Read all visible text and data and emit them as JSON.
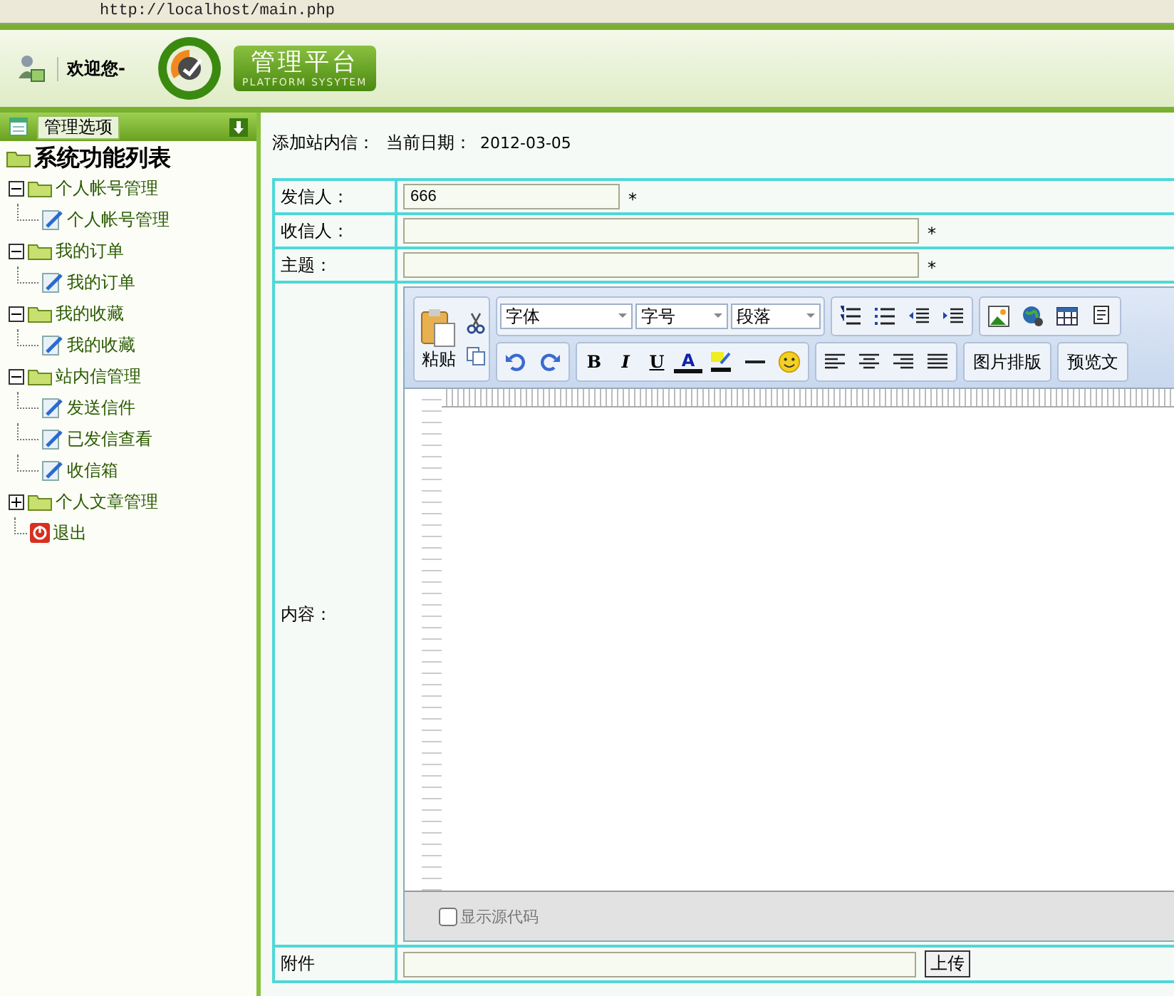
{
  "address_bar": {
    "url": "http://localhost/main.php"
  },
  "header": {
    "welcome": "欢迎您-",
    "brand": "管理平台",
    "brand_sub": "PLATFORM SYSYTEM"
  },
  "sidebar": {
    "title": "管理选项",
    "tree": {
      "label": "系统功能列表",
      "children": [
        {
          "label": "个人帐号管理",
          "expanded": true,
          "children": [
            {
              "label": "个人帐号管理"
            }
          ]
        },
        {
          "label": "我的订单",
          "expanded": true,
          "children": [
            {
              "label": "我的订单"
            }
          ]
        },
        {
          "label": "我的收藏",
          "expanded": true,
          "children": [
            {
              "label": "我的收藏"
            }
          ]
        },
        {
          "label": "站内信管理",
          "expanded": true,
          "children": [
            {
              "label": "发送信件"
            },
            {
              "label": "已发信查看"
            },
            {
              "label": "收信箱"
            }
          ]
        },
        {
          "label": "个人文章管理",
          "expanded": false
        }
      ],
      "exit": "退出"
    }
  },
  "content": {
    "heading": "添加站内信：",
    "date_label": "当前日期：",
    "date": "2012-03-05",
    "fields": [
      {
        "label": "发信人：",
        "value": "666",
        "required": "*"
      },
      {
        "label": "收信人：",
        "required": "*"
      },
      {
        "label": "主题：",
        "required": "*"
      }
    ],
    "editor": {
      "label": "内容：",
      "paste": "粘贴",
      "selects": [
        "字体",
        "字号",
        "段落"
      ],
      "format_buttons": [
        "B",
        "I",
        "U",
        "A"
      ],
      "text_buttons": [
        "图片排版",
        "预览文"
      ],
      "source_toggle": {
        "label": "显示源代码",
        "checked": false
      }
    },
    "attachment": {
      "label": "附件",
      "button": "上传"
    }
  }
}
